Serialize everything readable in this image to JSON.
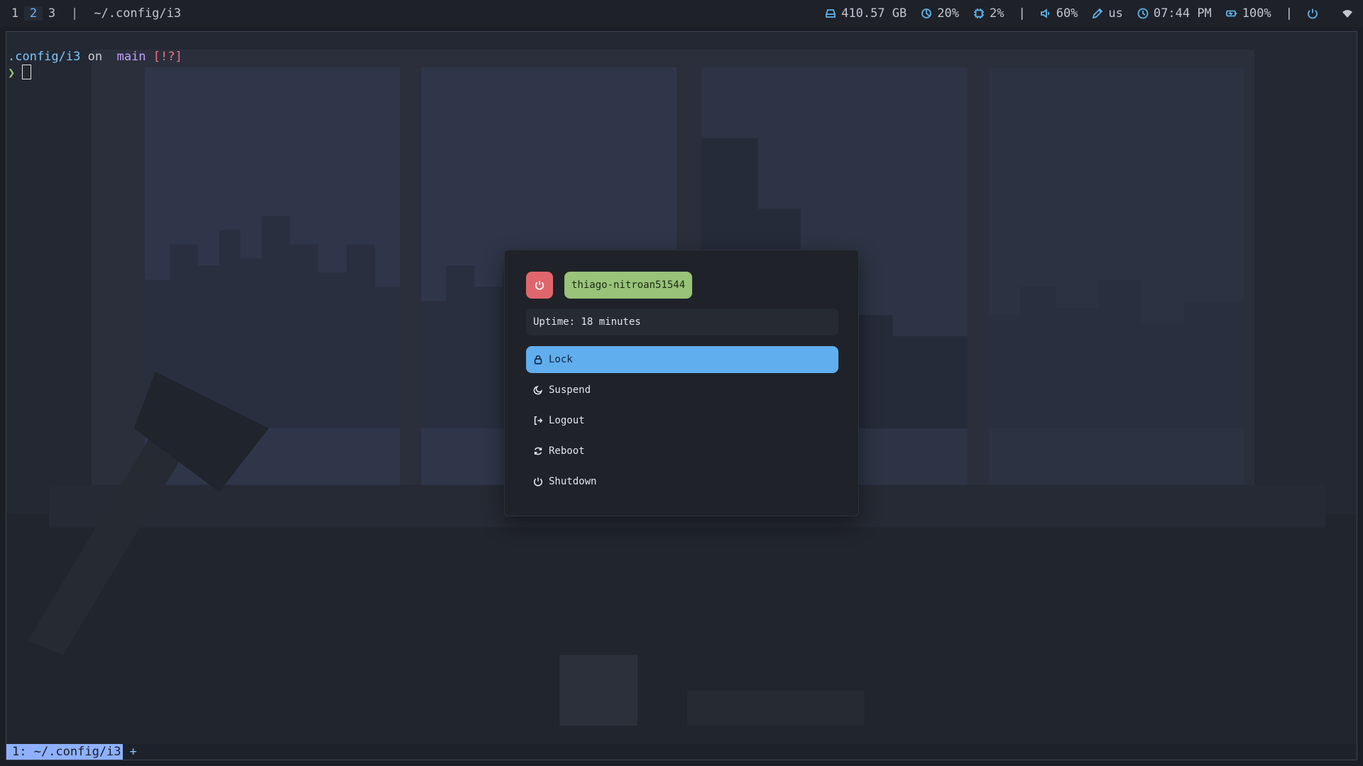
{
  "topbar": {
    "workspaces": [
      "1",
      "2",
      "3"
    ],
    "active_workspace": "2",
    "separator": "|",
    "window_title": "~/.config/i3",
    "modules": {
      "disk": "410.57 GB",
      "cpu": "20%",
      "memory": "2%",
      "volume": "60%",
      "keyboard": "us",
      "time": "07:44 PM",
      "battery": "100%"
    },
    "icons": [
      "disk-icon",
      "cpu-icon",
      "memory-icon",
      "volume-icon",
      "keyboard-icon",
      "clock-icon",
      "battery-icon",
      "power-icon",
      "wifi-icon"
    ],
    "accent_color": "#5fb4e9"
  },
  "terminal": {
    "dir": ".config/i3",
    "on": "on",
    "branch_glyph": "",
    "branch": "main",
    "status": "[!?]",
    "caret": "❯",
    "tmux_window": "1: ~/.config/i3",
    "tmux_plus": "+"
  },
  "powermenu": {
    "hostname": "thiago-nitroan51544",
    "uptime": "Uptime: 18 minutes",
    "options": [
      {
        "label": "Lock",
        "icon": "lock-icon"
      },
      {
        "label": "Suspend",
        "icon": "moon-icon"
      },
      {
        "label": "Logout",
        "icon": "logout-icon"
      },
      {
        "label": "Reboot",
        "icon": "reboot-icon"
      },
      {
        "label": "Shutdown",
        "icon": "power-icon"
      }
    ],
    "selected": "Lock",
    "colors": {
      "power_button": "#e0666d",
      "hostname": "#98c379",
      "selected": "#61aeee"
    }
  }
}
